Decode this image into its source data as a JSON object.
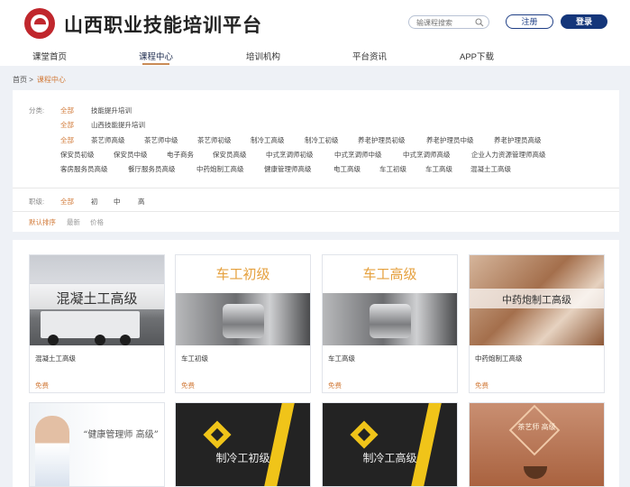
{
  "site": {
    "title": "山西职业技能培训平台"
  },
  "header": {
    "search_placeholder": "输课程搜索",
    "register_label": "注册",
    "login_label": "登录"
  },
  "nav": [
    {
      "label": "课堂首页"
    },
    {
      "label": "课程中心"
    },
    {
      "label": "培训机构"
    },
    {
      "label": "平台资讯"
    },
    {
      "label": "APP下载"
    }
  ],
  "breadcrumb": {
    "home": "首页 >",
    "current": "课程中心"
  },
  "filters": {
    "category_label": "分类:",
    "level_label": "职级:",
    "row1": [
      "全部",
      "技能提升培训"
    ],
    "row2": [
      "全部",
      "山西技能提升培训"
    ],
    "row3": [
      "全部",
      "茶艺师高级",
      "茶艺师中级",
      "茶艺师初级",
      "制冷工高级",
      "制冷工初级",
      "养老护理员初级",
      "养老护理员中级",
      "养老护理员高级"
    ],
    "row4": [
      "保安员初级",
      "保安员中级",
      "电子商务",
      "保安员高级",
      "中式烹调师初级",
      "中式烹调师中级",
      "中式烹调师高级",
      "企业人力资源管理师高级"
    ],
    "row5": [
      "客房服务员高级",
      "餐厅服务员高级",
      "中药炮制工高级",
      "健康管理师高级",
      "电工高级",
      "车工初级",
      "车工高级",
      "混凝土工高级"
    ],
    "levels": [
      "全部",
      "初",
      "中",
      "高"
    ],
    "sort": [
      "默认排序",
      "最新",
      "价格"
    ]
  },
  "courses": [
    {
      "thumb_text": "混凝土工高级",
      "title": "混凝土工高级",
      "price": "免费"
    },
    {
      "thumb_text": "车工初级",
      "title": "车工初级",
      "price": "免费"
    },
    {
      "thumb_text": "车工高级",
      "title": "车工高级",
      "price": "免费"
    },
    {
      "thumb_text": "中药炮制工高级",
      "title": "中药炮制工高级",
      "price": "免费"
    },
    {
      "thumb_text": "“健康管理师 高级”"
    },
    {
      "thumb_text": "制冷工初级"
    },
    {
      "thumb_text": "制冷工高级"
    },
    {
      "thumb_text": "茶艺师 高级"
    }
  ],
  "colors": {
    "accent": "#d27b3a",
    "brand": "#14367a",
    "logo": "#c0272d"
  }
}
